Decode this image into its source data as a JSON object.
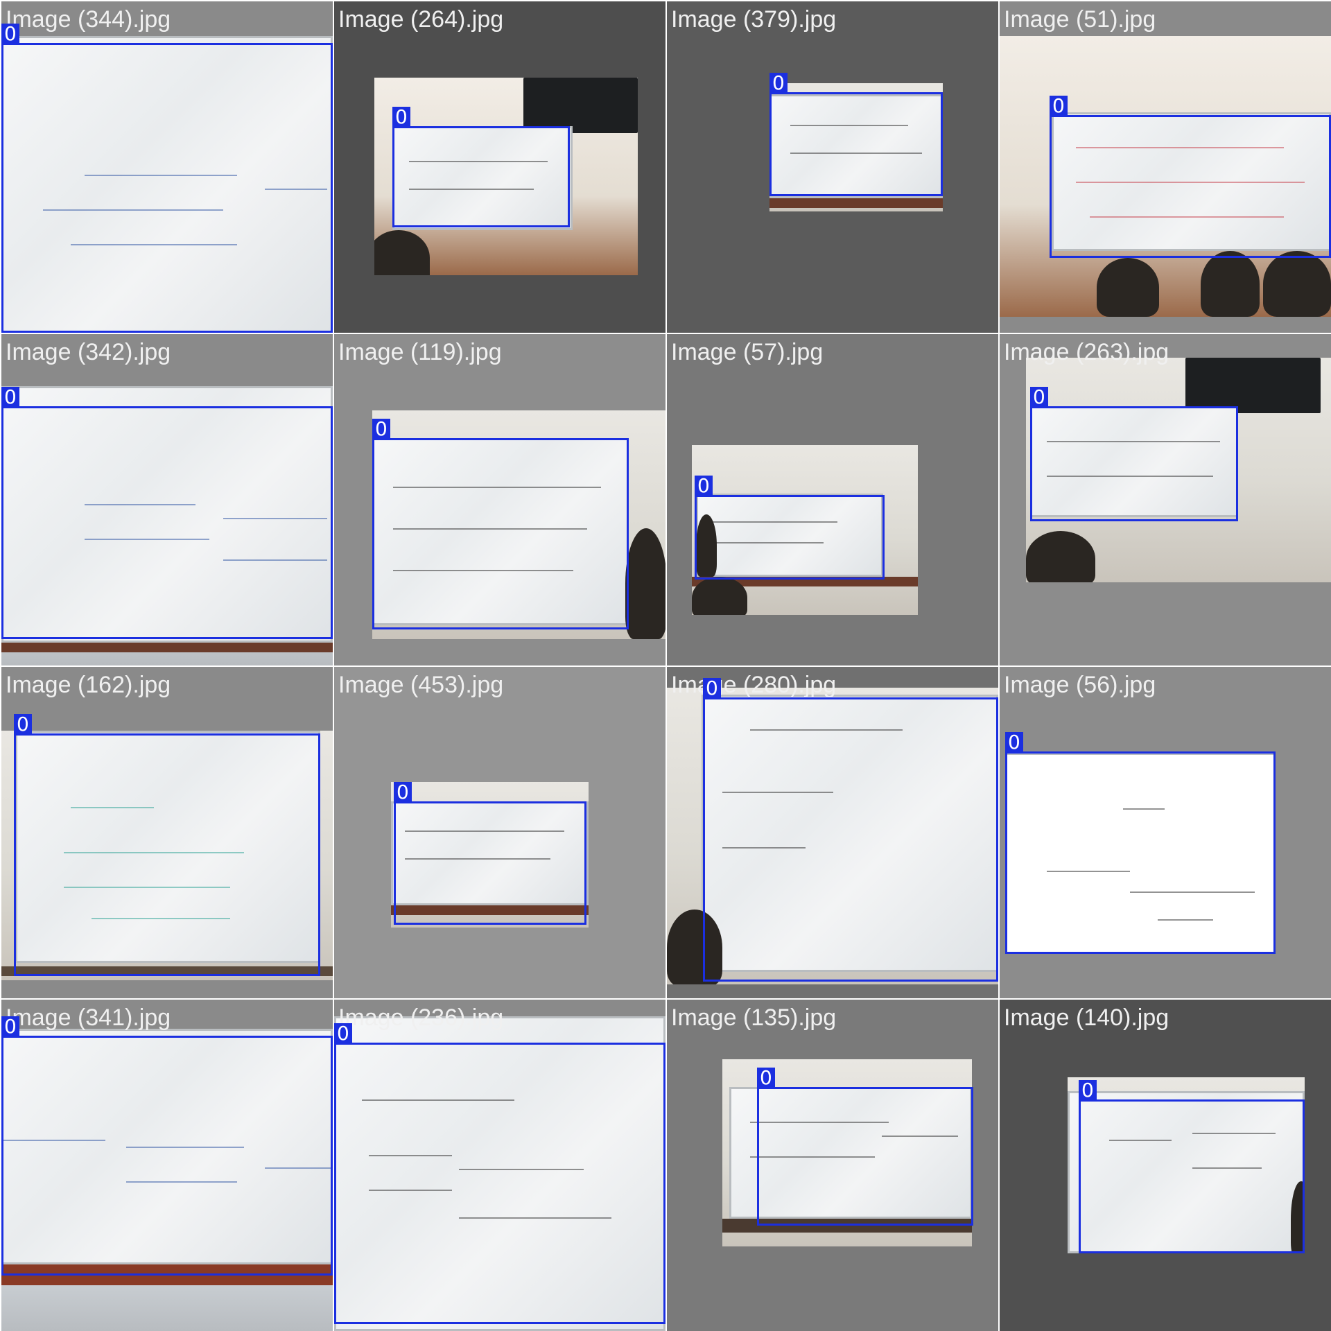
{
  "colors": {
    "bbox": "#1b2fe0",
    "bbox_label_text": "#ffffff",
    "title_text": "#f0f0f0"
  },
  "tiles": [
    {
      "title": "Image (344).jpg",
      "label": "0",
      "pad": "#8a8a8a"
    },
    {
      "title": "Image (264).jpg",
      "label": "0",
      "pad": "#4e4e4e"
    },
    {
      "title": "Image (379).jpg",
      "label": "0",
      "pad": "#5b5b5b"
    },
    {
      "title": "Image (51).jpg",
      "label": "0",
      "pad": "#8a8a8a"
    },
    {
      "title": "Image (342).jpg",
      "label": "0",
      "pad": "#8a8a8a"
    },
    {
      "title": "Image (119).jpg",
      "label": "0",
      "pad": "#8d8d8d"
    },
    {
      "title": "Image (57).jpg",
      "label": "0",
      "pad": "#787878"
    },
    {
      "title": "Image (263).jpg",
      "label": "0",
      "pad": "#8c8c8c"
    },
    {
      "title": "Image (162).jpg",
      "label": "0",
      "pad": "#8a8a8a"
    },
    {
      "title": "Image (453).jpg",
      "label": "0",
      "pad": "#959595"
    },
    {
      "title": "Image (280).jpg",
      "label": "0",
      "pad": "#707070"
    },
    {
      "title": "Image (56).jpg",
      "label": "0",
      "pad": "#8c8c8c"
    },
    {
      "title": "Image (341).jpg",
      "label": "0",
      "pad": "#8a8a8a"
    },
    {
      "title": "Image (236).jpg",
      "label": "0",
      "pad": "#8a8a8a"
    },
    {
      "title": "Image (135).jpg",
      "label": "0",
      "pad": "#7a7a7a"
    },
    {
      "title": "Image (140).jpg",
      "label": "0",
      "pad": "#505050"
    }
  ]
}
